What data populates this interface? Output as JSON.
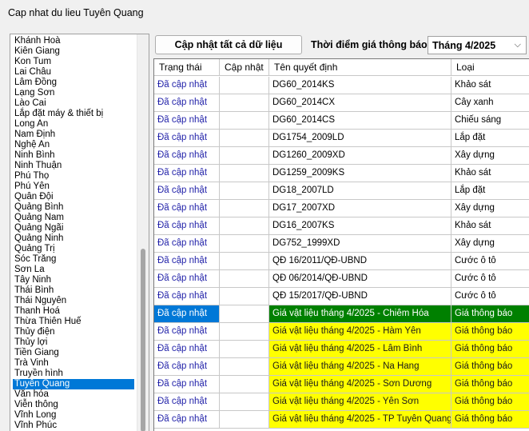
{
  "window": {
    "title": "Cap nhat du lieu Tuyên Quang"
  },
  "provinces": {
    "items": [
      "Khánh Hoà",
      "Kiên Giang",
      "Kon Tum",
      "Lai Châu",
      "Lâm Đồng",
      "Lạng Sơn",
      "Lào Cai",
      "Lắp đặt máy & thiết bị",
      "Long An",
      "Nam Định",
      "Nghệ An",
      "Ninh Bình",
      "Ninh Thuận",
      "Phú Thọ",
      "Phú Yên",
      "Quân Đội",
      "Quảng Bình",
      "Quảng Nam",
      "Quảng Ngãi",
      "Quảng Ninh",
      "Quảng Trị",
      "Sóc Trăng",
      "Sơn La",
      "Tây Ninh",
      "Thái Bình",
      "Thái Nguyên",
      "Thanh Hoá",
      "Thừa Thiên Huế",
      "Thủy điện",
      "Thủy lợi",
      "Tiền Giang",
      "Trà Vinh",
      "Truyền hình",
      "Tuyên Quang",
      "Văn hóa",
      "Viễn thông",
      "Vĩnh Long",
      "Vĩnh Phúc"
    ],
    "selected": "Tuyên Quang"
  },
  "toolbar": {
    "update_all_label": "Cập nhật tất cả dữ liệu",
    "time_label": "Thời điểm giá thông báo",
    "month_value": "Tháng 4/2025"
  },
  "grid": {
    "columns": [
      "Trạng thái",
      "Cập nhật",
      "Tên quyết định",
      "Loại"
    ],
    "rows": [
      {
        "status": "Đã cập nhật",
        "update": "",
        "name": "DG60_2014KS",
        "type": "Khảo sát",
        "style": ""
      },
      {
        "status": "Đã cập nhật",
        "update": "",
        "name": "DG60_2014CX",
        "type": "Cây xanh",
        "style": ""
      },
      {
        "status": "Đã cập nhật",
        "update": "",
        "name": "DG60_2014CS",
        "type": "Chiếu sáng",
        "style": ""
      },
      {
        "status": "Đã cập nhật",
        "update": "",
        "name": "DG1754_2009LD",
        "type": "Lắp đặt",
        "style": ""
      },
      {
        "status": "Đã cập nhật",
        "update": "",
        "name": "DG1260_2009XD",
        "type": "Xây dựng",
        "style": ""
      },
      {
        "status": "Đã cập nhật",
        "update": "",
        "name": "DG1259_2009KS",
        "type": "Khảo sát",
        "style": ""
      },
      {
        "status": "Đã cập nhật",
        "update": "",
        "name": "DG18_2007LD",
        "type": "Lắp đặt",
        "style": ""
      },
      {
        "status": "Đã cập nhật",
        "update": "",
        "name": "DG17_2007XD",
        "type": "Xây dựng",
        "style": ""
      },
      {
        "status": "Đã cập nhật",
        "update": "",
        "name": "DG16_2007KS",
        "type": "Khảo sát",
        "style": ""
      },
      {
        "status": "Đã cập nhật",
        "update": "",
        "name": "DG752_1999XD",
        "type": "Xây dựng",
        "style": ""
      },
      {
        "status": "Đã cập nhật",
        "update": "",
        "name": "QĐ 16/2011/QĐ-UBND",
        "type": "Cước ô tô",
        "style": ""
      },
      {
        "status": "Đã cập nhật",
        "update": "",
        "name": "QĐ 06/2014/QĐ-UBND",
        "type": "Cước ô tô",
        "style": ""
      },
      {
        "status": "Đã cập nhật",
        "update": "",
        "name": "QĐ 15/2017/QĐ-UBND",
        "type": "Cước ô tô",
        "style": ""
      },
      {
        "status": "Đã cập nhật",
        "update": "",
        "name": "Giá vật liệu tháng 4/2025 - Chiêm Hóa",
        "type": "Giá thông báo",
        "style": "green selected"
      },
      {
        "status": "Đã cập nhật",
        "update": "",
        "name": "Giá vật liệu tháng 4/2025 - Hàm Yên",
        "type": "Giá thông báo",
        "style": "yellow"
      },
      {
        "status": "Đã cập nhật",
        "update": "",
        "name": "Giá vật liệu tháng 4/2025 - Lâm Bình",
        "type": "Giá thông báo",
        "style": "yellow"
      },
      {
        "status": "Đã cập nhật",
        "update": "",
        "name": "Giá vật liệu tháng 4/2025 - Na Hang",
        "type": "Giá thông báo",
        "style": "yellow"
      },
      {
        "status": "Đã cập nhật",
        "update": "",
        "name": "Giá vật liệu tháng 4/2025 - Sơn Dương",
        "type": "Giá thông báo",
        "style": "yellow"
      },
      {
        "status": "Đã cập nhật",
        "update": "",
        "name": "Giá vật liệu tháng 4/2025 - Yên Sơn",
        "type": "Giá thông báo",
        "style": "yellow"
      },
      {
        "status": "Đã cập nhật",
        "update": "",
        "name": "Giá vật liệu tháng 4/2025 - TP Tuyên Quang",
        "type": "Giá thông báo",
        "style": "yellow"
      }
    ]
  },
  "colors": {
    "accent": "#0078d7",
    "green_row": "#008000",
    "yellow_row": "#ffff00",
    "status_text": "#1f1fa8"
  }
}
